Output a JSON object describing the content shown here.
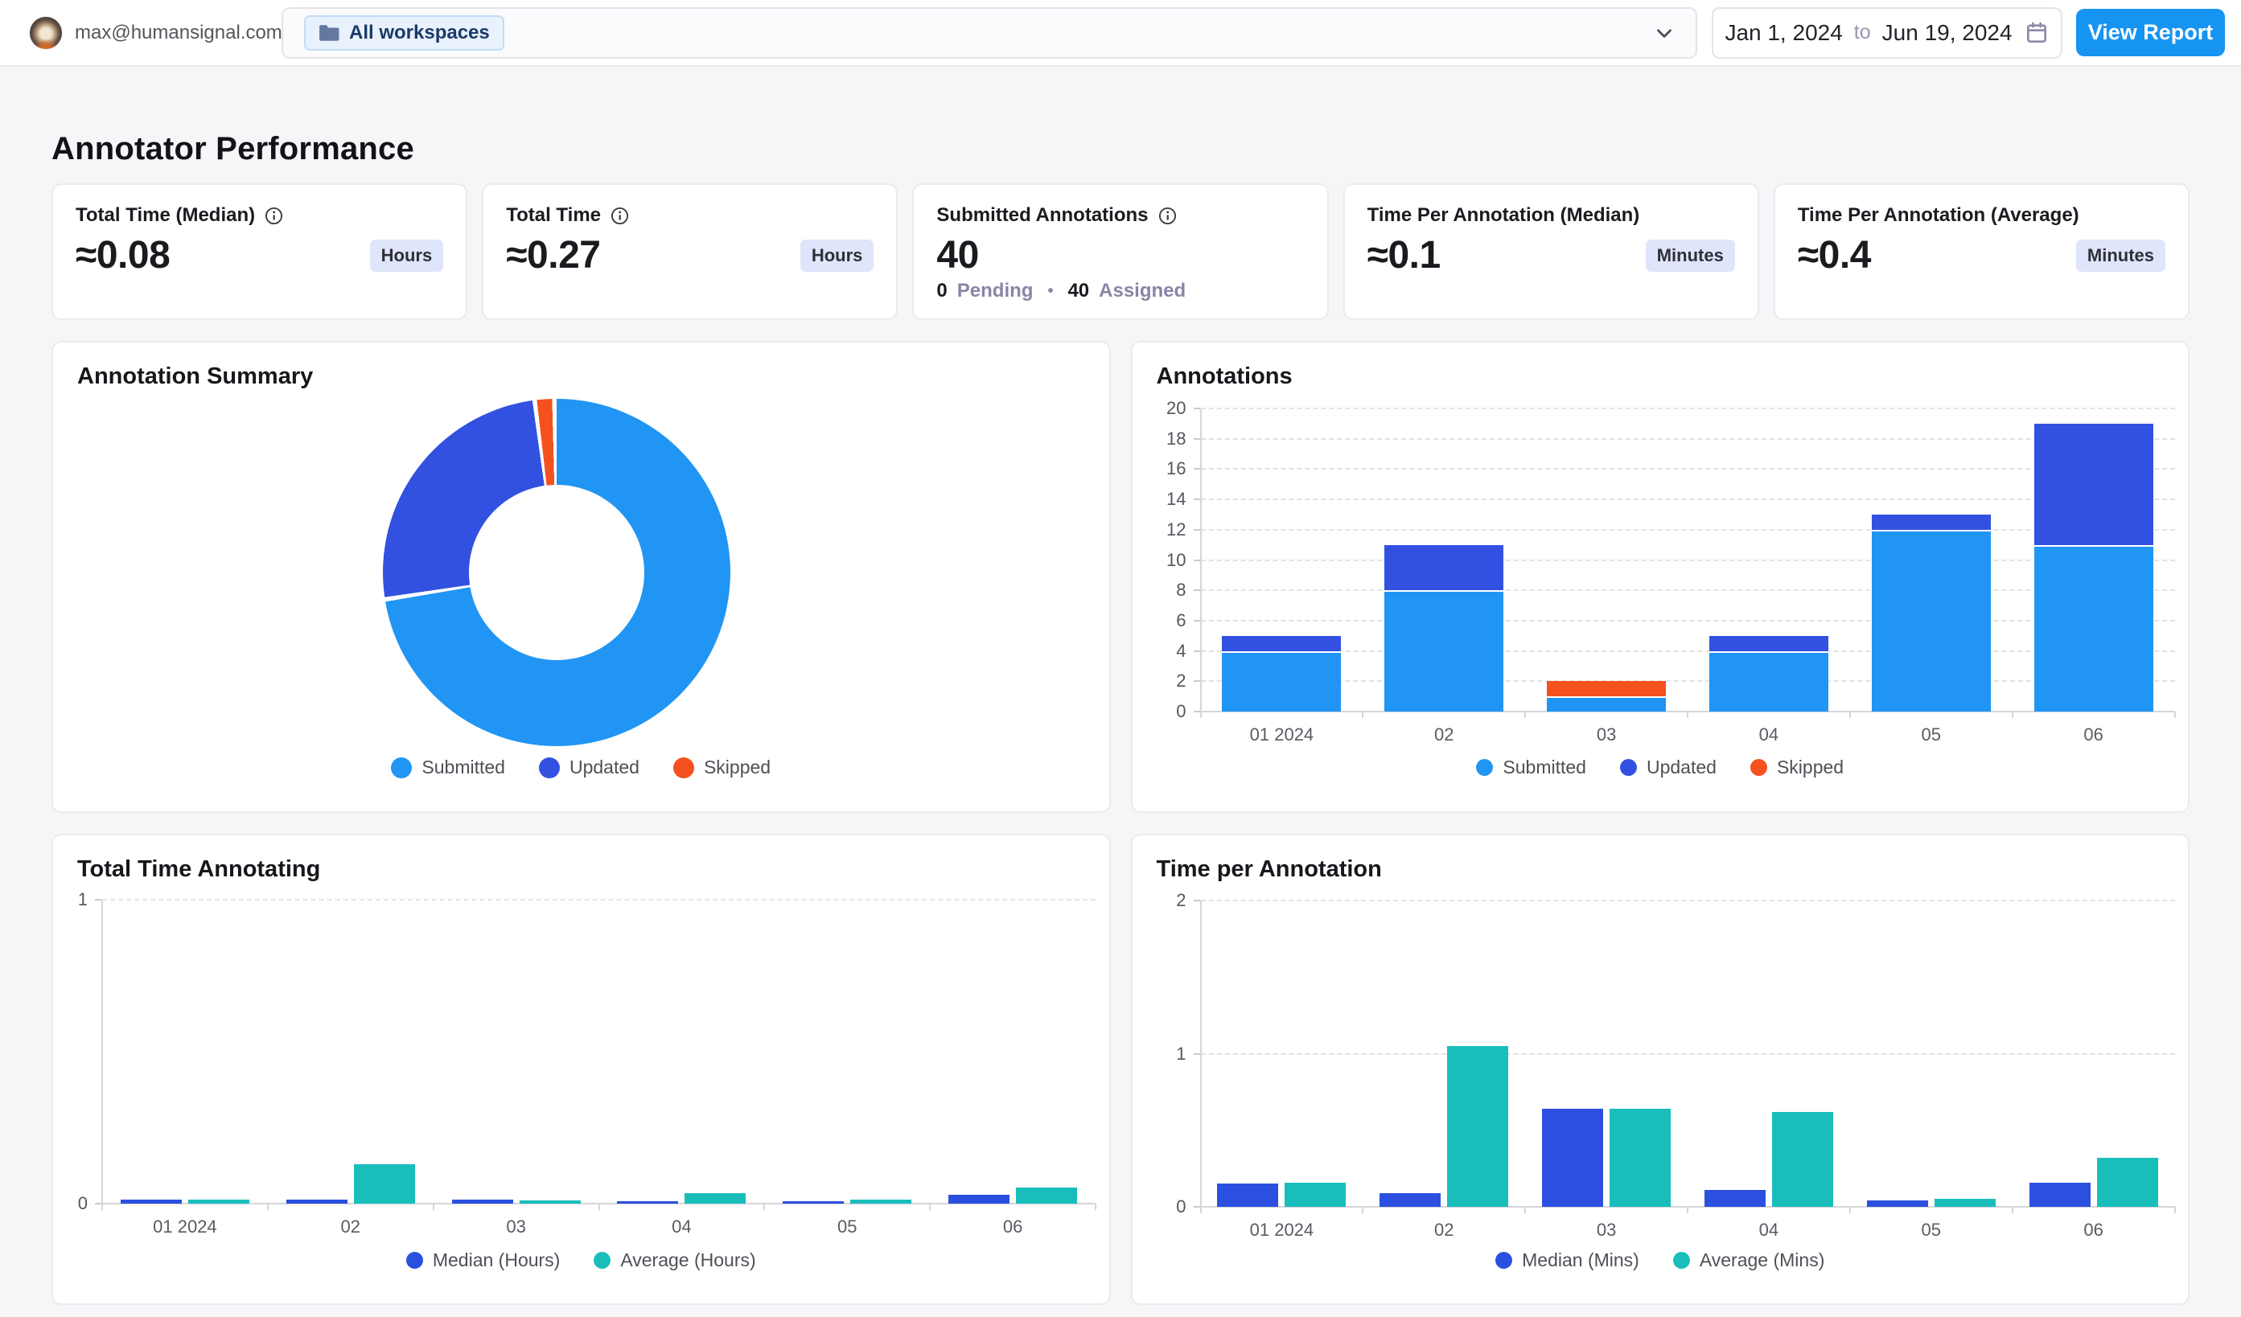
{
  "header": {
    "email": "max@humansignal.com",
    "workspace_filter": "All workspaces",
    "date_from": "Jan 1, 2024",
    "date_joiner": "to",
    "date_to": "Jun 19, 2024",
    "view_report_label": "View Report"
  },
  "page_title": "Annotator Performance",
  "stat_cards": [
    {
      "label": "Total Time (Median)",
      "value": "≈0.08",
      "unit": "Hours"
    },
    {
      "label": "Total Time",
      "value": "≈0.27",
      "unit": "Hours"
    },
    {
      "label": "Submitted Annotations",
      "value": "40",
      "pending_value": "0",
      "pending_label": "Pending",
      "separator": "•",
      "assigned_value": "40",
      "assigned_label": "Assigned"
    },
    {
      "label": "Time Per Annotation (Median)",
      "value": "≈0.1",
      "unit": "Minutes"
    },
    {
      "label": "Time Per Annotation (Average)",
      "value": "≈0.4",
      "unit": "Minutes"
    }
  ],
  "colors": {
    "accent": "#1594F2",
    "submitted": "#2095F3",
    "updated": "#3351E0",
    "skipped": "#F4511E",
    "median": "#2B50E0",
    "average": "#19BEBB",
    "badge_bg": "#DFE5FB"
  },
  "chart_data": [
    {
      "type": "pie",
      "donut": true,
      "title": "Annotation Summary",
      "labels": [
        "Submitted",
        "Updated",
        "Skipped"
      ],
      "values": [
        40,
        14,
        1
      ],
      "colors": [
        "#2095F3",
        "#3351E0",
        "#F4511E"
      ],
      "legend_position": "bottom"
    },
    {
      "type": "bar",
      "stacked": true,
      "title": "Annotations",
      "categories": [
        "01 2024",
        "02",
        "03",
        "04",
        "05",
        "06"
      ],
      "series": [
        {
          "name": "Submitted",
          "color": "#2095F3",
          "values": [
            4,
            8,
            1,
            4,
            12,
            11
          ]
        },
        {
          "name": "Updated",
          "color": "#3351E0",
          "values": [
            1,
            3,
            0,
            1,
            1,
            8
          ]
        },
        {
          "name": "Skipped",
          "color": "#F4511E",
          "values": [
            0,
            0,
            1,
            0,
            0,
            0
          ]
        }
      ],
      "ylim": [
        0,
        20
      ],
      "yticks": [
        0,
        2,
        4,
        6,
        8,
        10,
        12,
        14,
        16,
        18,
        20
      ],
      "grid": "dashed",
      "legend_position": "bottom"
    },
    {
      "type": "bar",
      "stacked": false,
      "title": "Total Time Annotating",
      "categories": [
        "01 2024",
        "02",
        "03",
        "04",
        "05",
        "06"
      ],
      "series": [
        {
          "name": "Median (Hours)",
          "color": "#2B50E0",
          "values": [
            0.012,
            0.013,
            0.012,
            0.009,
            0.008,
            0.028
          ]
        },
        {
          "name": "Average (Hours)",
          "color": "#19BEBB",
          "values": [
            0.013,
            0.13,
            0.011,
            0.034,
            0.012,
            0.052
          ]
        }
      ],
      "ylim": [
        0,
        1
      ],
      "yticks": [
        0,
        1
      ],
      "grid": "dashed",
      "legend_position": "bottom"
    },
    {
      "type": "bar",
      "stacked": false,
      "title": "Time per Annotation",
      "categories": [
        "01 2024",
        "02",
        "03",
        "04",
        "05",
        "06"
      ],
      "series": [
        {
          "name": "Median (Mins)",
          "color": "#2B50E0",
          "values": [
            0.15,
            0.09,
            0.64,
            0.11,
            0.04,
            0.16
          ]
        },
        {
          "name": "Average (Mins)",
          "color": "#19BEBB",
          "values": [
            0.16,
            1.05,
            0.64,
            0.62,
            0.055,
            0.32
          ]
        }
      ],
      "ylim": [
        0,
        2
      ],
      "yticks": [
        0,
        1,
        2
      ],
      "grid": "dashed",
      "legend_position": "bottom"
    }
  ]
}
